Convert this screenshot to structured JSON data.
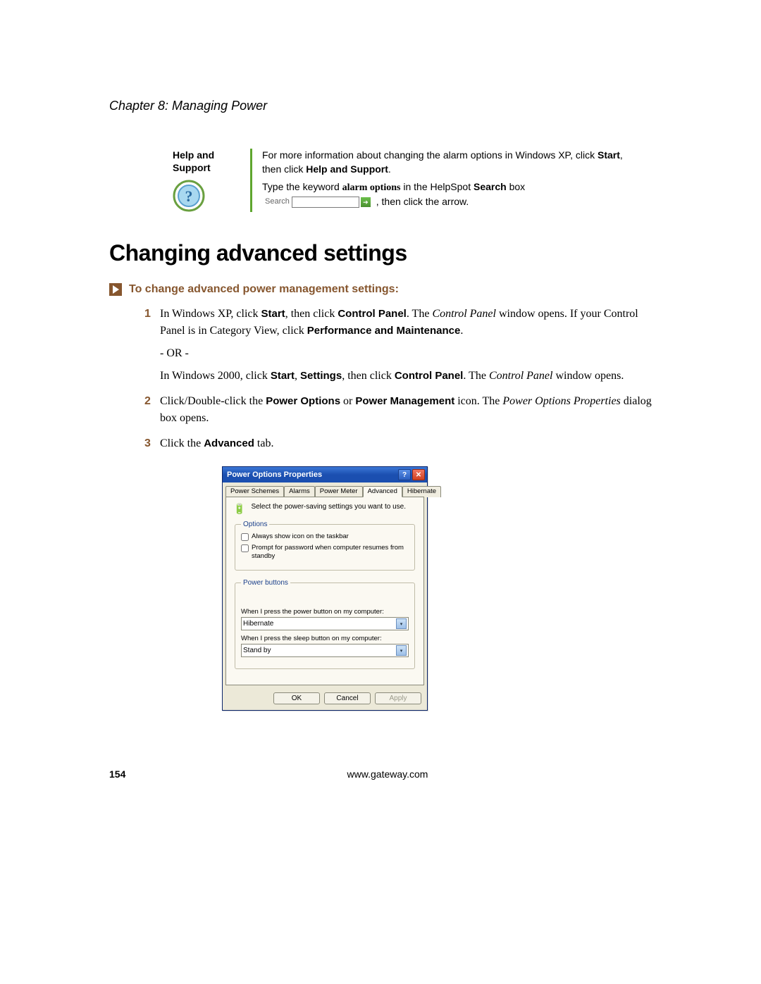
{
  "chapter_header": "Chapter 8: Managing Power",
  "help": {
    "label_line1": "Help and",
    "label_line2": "Support",
    "body1_pre": "For more information about changing the alarm options in Windows XP, click ",
    "body1_b1": "Start",
    "body1_mid": ", then click ",
    "body1_b2": "Help and Support",
    "body1_end": ".",
    "body2_pre": "Type the keyword ",
    "body2_kw": "alarm options",
    "body2_mid": " in the HelpSpot ",
    "body2_b1": "Search",
    "body2_aft": " box ",
    "search_label": "Search",
    "body2_tail": " , then click the arrow."
  },
  "section_heading": "Changing advanced settings",
  "procedure_title": "To change advanced power management settings:",
  "steps": {
    "s1_num": "1",
    "s1_a1": "In Windows XP, click ",
    "s1_b1": "Start",
    "s1_a2": ", then click ",
    "s1_b2": "Control Panel",
    "s1_a3": ". The ",
    "s1_i1": "Control Panel",
    "s1_a4": " window opens. If your Control Panel is in Category View, click ",
    "s1_b3": "Performance and Maintenance",
    "s1_a5": ".",
    "or": "- OR -",
    "s1b_a1": "In Windows 2000, click ",
    "s1b_b1": "Start",
    "s1b_a2": ", ",
    "s1b_b2": "Settings",
    "s1b_a3": ", then click ",
    "s1b_b3": "Control Panel",
    "s1b_a4": ". The ",
    "s1b_i1": "Control Panel",
    "s1b_a5": " window opens.",
    "s2_num": "2",
    "s2_a1": "Click/Double-click the ",
    "s2_b1": "Power Options",
    "s2_a2": " or ",
    "s2_b2": "Power Management",
    "s2_a3": " icon. The ",
    "s2_i1": "Power Options Properties",
    "s2_a4": " dialog box opens.",
    "s3_num": "3",
    "s3_a1": "Click the ",
    "s3_b1": "Advanced",
    "s3_a2": " tab."
  },
  "dialog": {
    "title": "Power Options Properties",
    "tabs": [
      "Power Schemes",
      "Alarms",
      "Power Meter",
      "Advanced",
      "Hibernate"
    ],
    "active_tab_index": 3,
    "intro": "Select the power-saving settings you want to use.",
    "group_options": "Options",
    "chk1": "Always show icon on the taskbar",
    "chk2": "Prompt for password when computer resumes from standby",
    "group_power": "Power buttons",
    "pb1_label": "When I press the power button on my computer:",
    "pb1_value": "Hibernate",
    "pb2_label": "When I press the sleep button on my computer:",
    "pb2_value": "Stand by",
    "btn_ok": "OK",
    "btn_cancel": "Cancel",
    "btn_apply": "Apply"
  },
  "footer": {
    "page": "154",
    "url": "www.gateway.com"
  }
}
